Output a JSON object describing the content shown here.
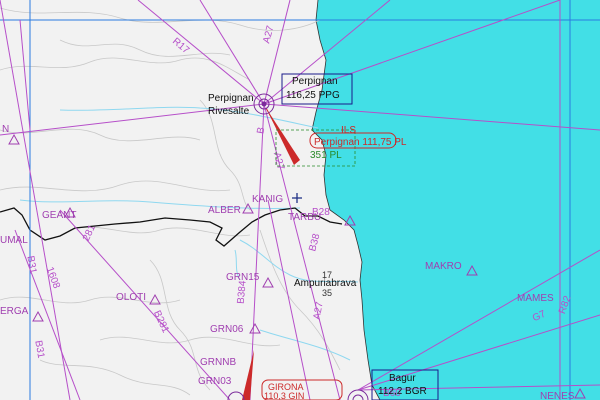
{
  "colors": {
    "land": "#f2f2f2",
    "sea": "#42dfe6",
    "airway": "#b64fc9",
    "grid": "#2a7be0",
    "border": "#111111",
    "river": "#8fd8f0",
    "ils": "#cc2a2a",
    "fix": "#a03fb0",
    "terrain_green": "#2a8a2a"
  },
  "airports": {
    "perpignan": {
      "name_1": "Perpignan",
      "name_2": "Rivesalte"
    },
    "ampuriabrava": {
      "name": "Ampuriabrava",
      "elev_1": "17",
      "elev_2": "35"
    }
  },
  "navaids": {
    "perpignan_vor": {
      "name": "Perpignan",
      "freq": "116,25 PPG"
    },
    "bagur_vor": {
      "name": "Bagur",
      "freq": "112,2 BGR"
    },
    "perpignan_ils": {
      "name": "ILS",
      "freq": "Perpignan 111,75 PL",
      "loc": "351 PL"
    },
    "girona_ils": {
      "freq": "GIRONA",
      "freq2": "110,3 GIN"
    }
  },
  "fixes": {
    "alber": "ALBER",
    "kanig": "KANIG",
    "tarbu": "TARBU",
    "geant": "GEANT",
    "grn15": "GRN15",
    "grn06": "GRN06",
    "grnnb": "GRNNB",
    "grn03": "GRN03",
    "oloti": "OLOTI",
    "makro": "MAKRO",
    "mames": "MAMES",
    "erga": "ERGA",
    "umal": "UMAL",
    "nenes": "NENES",
    "left_n": "N"
  },
  "airways": {
    "r17": "R17",
    "a27_top": "A27",
    "a27_mid": "A27",
    "a27_low": "A27",
    "b_top": "B",
    "b384": "B384",
    "b38": "B38",
    "b28": "B28",
    "b31": "B31",
    "b31b": "B31",
    "b1608": "1608",
    "b281": "B281",
    "b281b": "281",
    "g7": "G7",
    "r82": "R82",
    "b60": "B60"
  }
}
